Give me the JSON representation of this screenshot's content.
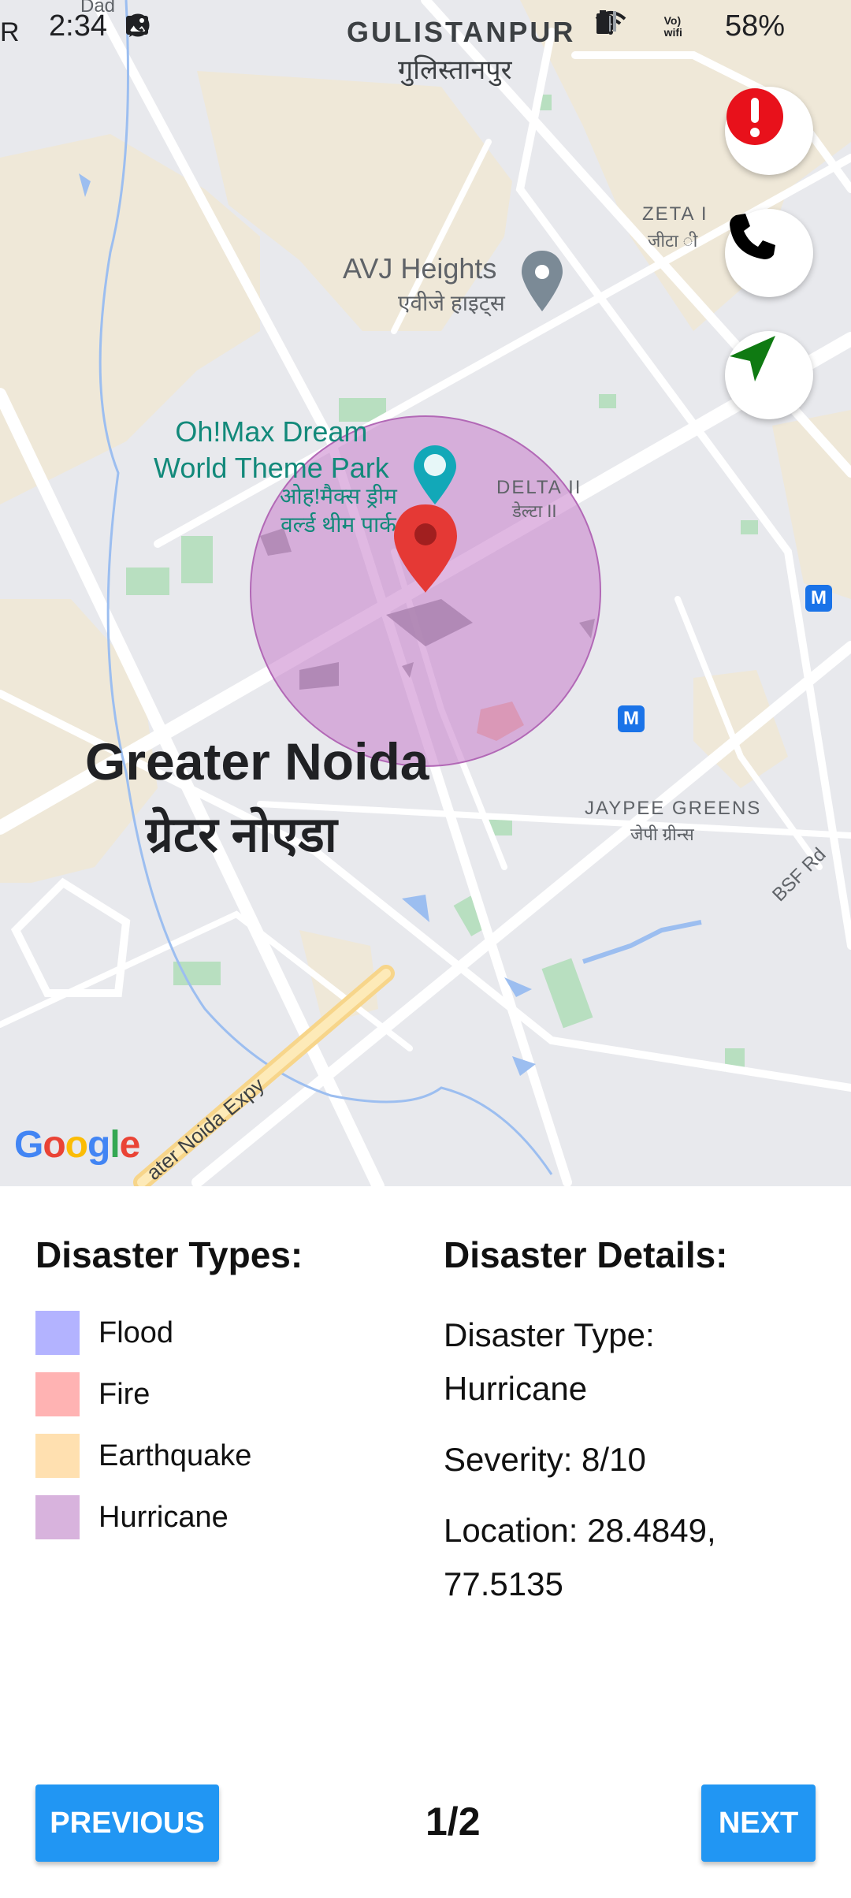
{
  "status_bar": {
    "left_glyph": "R",
    "time": "2:34",
    "battery": "58%",
    "network_label_top": "Vo)",
    "network_label_bottom": "wifi"
  },
  "map": {
    "labels": {
      "gulistanpur": "GULISTANPUR",
      "gulistanpur_hi": "गुलिस्तानपुर",
      "zeta": "ZETA I",
      "zeta_hi": "जीटा ी",
      "avj": "AVJ Heights",
      "avj_hi": "एवीजे हाइट्स",
      "ohmax_line1": "Oh!Max Dream",
      "ohmax_line2": "World Theme Park",
      "ohmax_hi_line1": "ओह!मैक्स ड्रीम",
      "ohmax_hi_line2": "वर्ल्ड थीम पार्क",
      "delta": "DELTA II",
      "delta_hi": "डेल्टा II",
      "greater_noida": "Greater Noida",
      "greater_noida_hi": "ग्रेटर नोएडा",
      "jaypee": "JAYPEE GREENS",
      "jaypee_hi": "जेपी ग्रीन्स",
      "bsf": "BSF Rd",
      "expy": "ater Noida Expy",
      "dad": "Dad",
      "metro": "M",
      "google": "Google"
    },
    "google_colors": [
      "#4285f4",
      "#ea4335",
      "#fbbc05",
      "#4285f4",
      "#34a853",
      "#ea4335"
    ],
    "hurricane_zone_color": "#c77dcb",
    "marker_color": "#e53935",
    "fab_alert_icon": "alert-icon",
    "fab_call_icon": "phone-icon",
    "fab_nav_icon": "navigation-arrow-icon"
  },
  "legend": {
    "title": "Disaster Types:",
    "items": [
      {
        "label": "Flood",
        "color": "#b3b3ff"
      },
      {
        "label": "Fire",
        "color": "#ffb3b3"
      },
      {
        "label": "Earthquake",
        "color": "#ffe0b0"
      },
      {
        "label": "Hurricane",
        "color": "#d8b3dd"
      }
    ]
  },
  "details": {
    "title": "Disaster Details:",
    "type_line1": "Disaster Type:",
    "type_line2": "Hurricane",
    "severity": "Severity: 8/10",
    "location_line1": "Location: 28.4849,",
    "location_line2": "77.5135"
  },
  "pager": {
    "previous": "PREVIOUS",
    "next": "NEXT",
    "page": "1/2"
  }
}
